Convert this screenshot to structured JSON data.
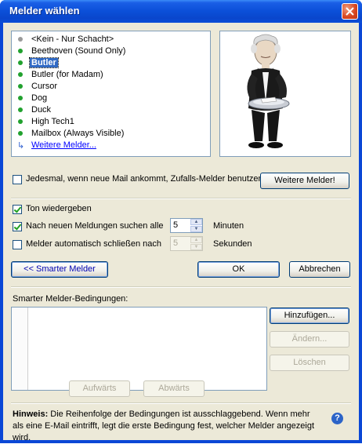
{
  "window": {
    "title": "Melder wählen"
  },
  "melder_list": [
    {
      "label": "<Kein - Nur Schacht>",
      "bullet": "gray"
    },
    {
      "label": "Beethoven (Sound Only)",
      "bullet": "green"
    },
    {
      "label": "Butler",
      "bullet": "green",
      "selected": true
    },
    {
      "label": "Butler (for Madam)",
      "bullet": "green"
    },
    {
      "label": "Cursor",
      "bullet": "green"
    },
    {
      "label": "Dog",
      "bullet": "green"
    },
    {
      "label": "Duck",
      "bullet": "green"
    },
    {
      "label": "High Tech1",
      "bullet": "green"
    },
    {
      "label": "Mailbox (Always Visible)",
      "bullet": "green"
    },
    {
      "label": "Weitere Melder...",
      "bullet": "arrow-link"
    }
  ],
  "options": {
    "random_label": "Jedesmal, wenn neue Mail ankommt, Zufalls-Melder benutzen",
    "random_checked": false,
    "more_button": "Weitere Melder!",
    "sound_label": "Ton wiedergeben",
    "sound_checked": true,
    "search_label": "Nach neuen Meldungen suchen alle",
    "search_checked": true,
    "search_value": "5",
    "search_unit": "Minuten",
    "close_label": "Melder automatisch schließen nach",
    "close_checked": false,
    "close_value": "5",
    "close_unit": "Sekunden"
  },
  "buttons": {
    "smarter": "<< Smarter Melder",
    "ok": "OK",
    "cancel": "Abbrechen",
    "add": "Hinzufügen...",
    "change": "Ändern...",
    "delete": "Löschen",
    "up": "Aufwärts",
    "down": "Abwärts"
  },
  "conditions": {
    "label": "Smarter Melder-Bedingungen:"
  },
  "hint": {
    "bold": "Hinweis:",
    "text": " Die Reihenfolge der Bedingungen ist ausschlaggebend. Wenn mehr als eine E-Mail eintrifft, legt die erste Bedingung fest, welcher Melder angezeigt wird."
  },
  "colors": {
    "titlebar": "#0b4fd8",
    "dialog": "#ece9d8",
    "selection": "#316ac5",
    "bullet": "#21a12e",
    "link": "#0000ff"
  },
  "icons": [
    "close-icon",
    "butler-image",
    "help-icon",
    "arrow-link-icon"
  ]
}
